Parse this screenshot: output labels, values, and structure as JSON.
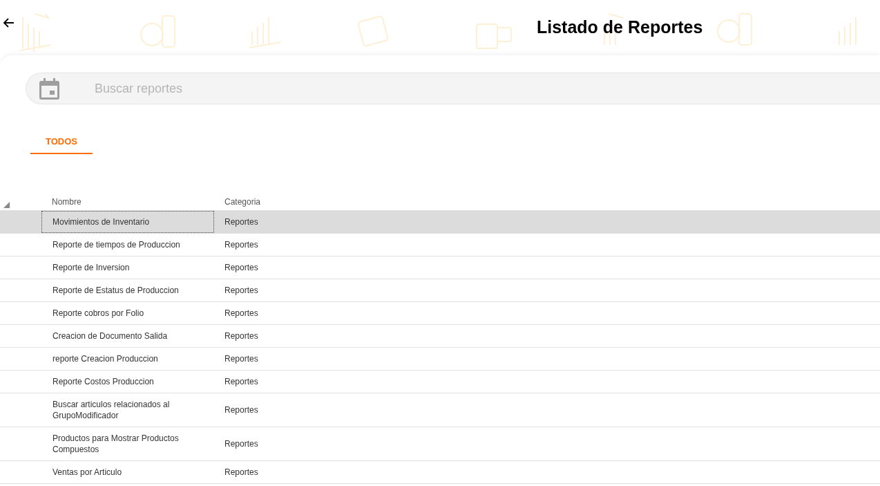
{
  "header": {
    "title": "Listado de Reportes"
  },
  "search": {
    "placeholder": "Buscar reportes"
  },
  "tabs": [
    {
      "label": "TODOS",
      "selected": true
    }
  ],
  "table": {
    "columns": [
      "Nombre",
      "Categoria"
    ],
    "rows": [
      {
        "nombre": "Movimientos de Inventario",
        "categoria": "Reportes",
        "selected": true
      },
      {
        "nombre": "Reporte de tiempos de Produccion",
        "categoria": "Reportes",
        "selected": false
      },
      {
        "nombre": "Reporte de Inversion",
        "categoria": "Reportes",
        "selected": false
      },
      {
        "nombre": "Reporte de Estatus de Produccion",
        "categoria": "Reportes",
        "selected": false
      },
      {
        "nombre": "Reporte cobros por Folio",
        "categoria": "Reportes",
        "selected": false
      },
      {
        "nombre": "Creacion de Documento Salida",
        "categoria": "Reportes",
        "selected": false
      },
      {
        "nombre": "reporte Creacion Produccion",
        "categoria": "Reportes",
        "selected": false
      },
      {
        "nombre": "Reporte Costos Produccion",
        "categoria": "Reportes",
        "selected": false
      },
      {
        "nombre": "Buscar articulos relacionados al GrupoModificador",
        "categoria": "Reportes",
        "selected": false
      },
      {
        "nombre": "Productos para Mostrar Productos Compuestos",
        "categoria": "Reportes",
        "selected": false
      },
      {
        "nombre": "Ventas por Articulo",
        "categoria": "Reportes",
        "selected": false
      }
    ]
  }
}
